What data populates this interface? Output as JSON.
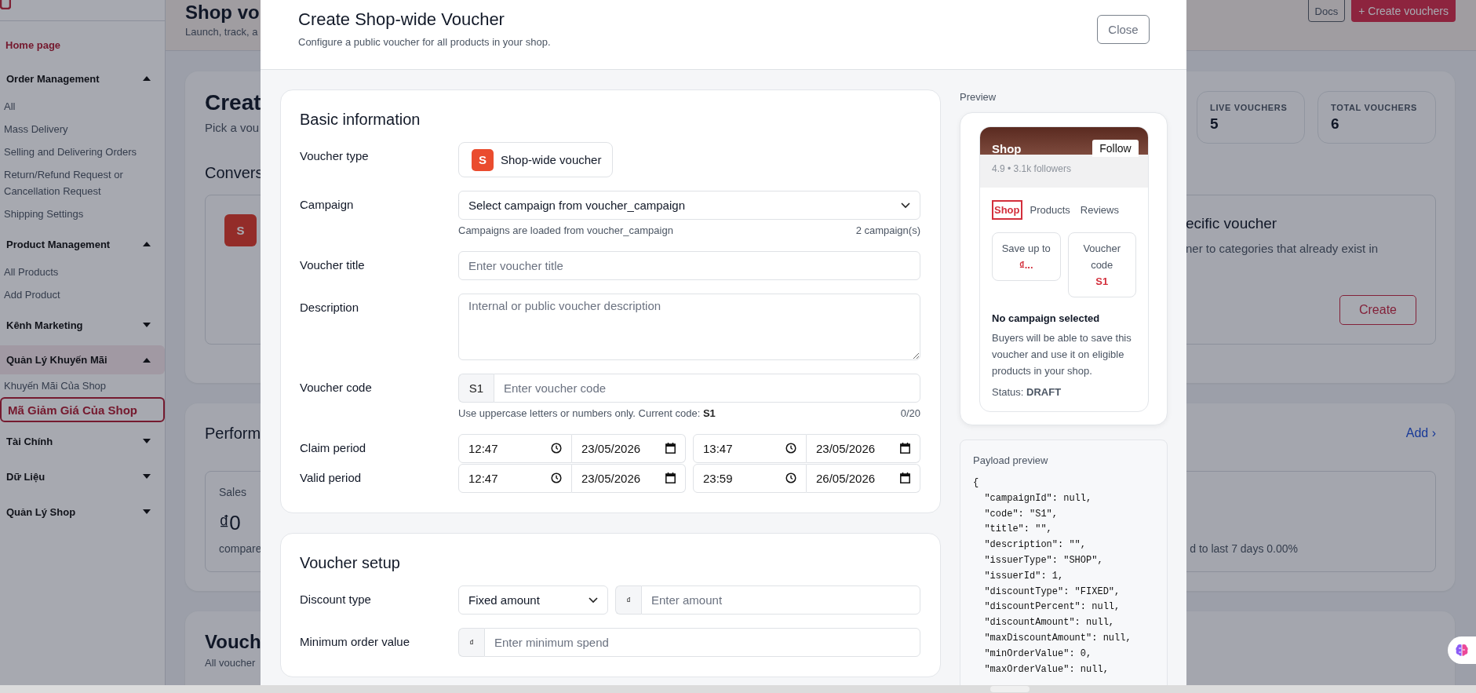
{
  "sidebar": {
    "items": [
      {
        "kind": "home",
        "label": "Home page",
        "selected": false
      },
      {
        "kind": "group",
        "label": "Order Management",
        "expanded": true,
        "active": false,
        "children": [
          {
            "label": "All",
            "selected": false
          },
          {
            "label": "Mass Delivery",
            "selected": false
          },
          {
            "label": "Selling and Delivering Orders",
            "selected": false
          },
          {
            "label": "Return/Refund Request or Cancellation Request",
            "selected": false
          },
          {
            "label": "Shipping Settings",
            "selected": false
          }
        ]
      },
      {
        "kind": "group",
        "label": "Product Management",
        "expanded": true,
        "active": false,
        "children": [
          {
            "label": "All Products",
            "selected": false
          },
          {
            "label": "Add Product",
            "selected": false
          }
        ]
      },
      {
        "kind": "group",
        "label": "Kênh Marketing",
        "expanded": false,
        "active": false
      },
      {
        "kind": "group",
        "label": "Quản Lý Khuyến Mãi",
        "expanded": true,
        "active": true,
        "children": [
          {
            "label": "Khuyến Mãi Của Shop",
            "selected": false
          },
          {
            "label": "Mã Giảm Giá Của Shop",
            "selected": true
          }
        ]
      },
      {
        "kind": "group",
        "label": "Tài Chính",
        "expanded": false,
        "active": false
      },
      {
        "kind": "group",
        "label": "Dữ Liệu",
        "expanded": false,
        "active": false
      },
      {
        "kind": "group",
        "label": "Quản Lý Shop",
        "expanded": false,
        "active": false
      }
    ]
  },
  "page": {
    "header": {
      "title": "Shop vo",
      "subtitle": "Launch, track, a",
      "buttons": [
        {
          "kind": "outline",
          "label": "Docs"
        },
        {
          "kind": "primary",
          "label": "+ Create vouchers"
        }
      ]
    },
    "create_card": {
      "title": "Creat",
      "subtitle": "Pick a vou",
      "stats": [
        {
          "label": "LIVE VOUCHERS",
          "value": "5"
        },
        {
          "label": "TOTAL VOUCHERS",
          "value": "6"
        }
      ],
      "section": "Convers",
      "option": {
        "icon_letter": "S",
        "title": "ecific voucher",
        "description": "ner to categories that already exist in",
        "button": "Create"
      }
    },
    "performance": {
      "title": "Perform",
      "link": "Add ›",
      "metric": {
        "label": "Sales",
        "value": "₫0",
        "comparison_left": "compare",
        "comparison_right": "d to last 7 days 0.00%"
      }
    },
    "vouchers": {
      "title": "Vouch",
      "subtitle": "All voucher"
    }
  },
  "modal": {
    "title": "Create Shop-wide Voucher",
    "subtitle": "Configure a public voucher for all products in your shop.",
    "close": "Close",
    "sections": [
      {
        "title": "Basic information",
        "rows": [
          {
            "kind": "chip",
            "label": "Voucher type",
            "icon_letter": "S",
            "value": "Shop-wide voucher"
          },
          {
            "kind": "select",
            "label": "Campaign",
            "value": "Select campaign from voucher_campaign",
            "hint": "Campaigns are loaded from voucher_campaign",
            "hint_right": "2 campaign(s)"
          },
          {
            "kind": "text",
            "label": "Voucher title",
            "placeholder": "Enter voucher title"
          },
          {
            "kind": "textarea",
            "label": "Description",
            "placeholder": "Internal or public voucher description"
          },
          {
            "kind": "prefixed",
            "label": "Voucher code",
            "prefix": "S1",
            "placeholder": "Enter voucher code",
            "hint": "Use uppercase letters or numbers only. Current code: **S1**",
            "hint_right": "0/20"
          },
          {
            "kind": "period",
            "label": "Claim period",
            "start_time": "12:47",
            "start_date": "23/05/2026",
            "end_time": "13:47",
            "end_date": "23/05/2026"
          },
          {
            "kind": "period",
            "label": "Valid period",
            "start_time": "12:47",
            "start_date": "23/05/2026",
            "end_time": "23:59",
            "end_date": "26/05/2026"
          }
        ]
      },
      {
        "title": "Voucher setup",
        "rows": [
          {
            "kind": "select_amount",
            "label": "Discount type",
            "value": "Fixed amount",
            "prefix": "₫",
            "placeholder": "Enter amount"
          },
          {
            "kind": "prefixed",
            "label": "Minimum order value",
            "prefix": "₫",
            "placeholder": "Enter minimum spend"
          }
        ]
      }
    ]
  },
  "preview": {
    "label": "Preview",
    "shop": {
      "name": "Shop",
      "follow": "Follow",
      "meta": "4.9 • 3.1k followers",
      "tabs": [
        {
          "label": "Shop",
          "selected": true
        },
        {
          "label": "Products",
          "selected": false
        },
        {
          "label": "Reviews",
          "selected": false
        }
      ],
      "offers": [
        {
          "label": "Save up to",
          "value": "₫..."
        },
        {
          "label": "Voucher code",
          "value": "S1"
        }
      ],
      "campaign": "No campaign selected",
      "description": "Buyers will be able to save this voucher and use it on eligible products in your shop.",
      "status": "Status: **DRAFT**"
    },
    "payload": {
      "label": "Payload preview",
      "lines": [
        "{",
        "  \"campaignId\": null,",
        "  \"code\": \"S1\",",
        "  \"title\": \"\",",
        "  \"description\": \"\",",
        "  \"issuerType\": \"SHOP\",",
        "  \"issuerId\": 1,",
        "  \"discountType\": \"FIXED\",",
        "  \"discountPercent\": null,",
        "  \"discountAmount\": null,",
        "  \"maxDiscountAmount\": null,",
        "  \"minOrderValue\": 0,",
        "  \"maxOrderValue\": null,"
      ]
    }
  }
}
